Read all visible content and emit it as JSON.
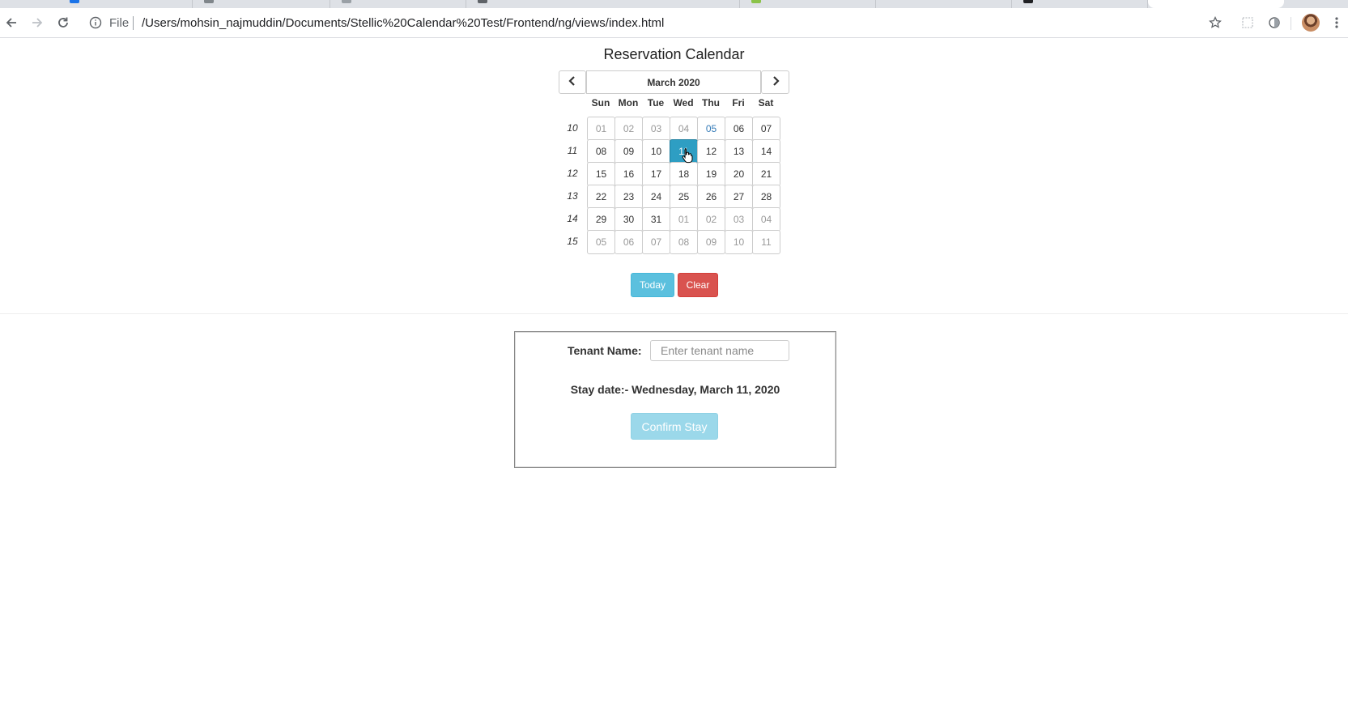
{
  "browser": {
    "scheme_label": "File",
    "url": "/Users/mohsin_najmuddin/Documents/Stellic%20Calendar%20Test/Frontend/ng/views/index.html",
    "icons": [
      "back-arrow-icon",
      "forward-arrow-icon",
      "reload-icon",
      "info-icon",
      "bookmark-star-icon",
      "extension-icon",
      "profile-circle-icon",
      "avatar",
      "more-vert-icon"
    ]
  },
  "page": {
    "title": "Reservation Calendar"
  },
  "calendar": {
    "month_label": "March 2020",
    "weekday_headers": [
      "Sun",
      "Mon",
      "Tue",
      "Wed",
      "Thu",
      "Fri",
      "Sat"
    ],
    "weeks": [
      {
        "number": "10",
        "days": [
          {
            "label": "01",
            "state": "muted"
          },
          {
            "label": "02",
            "state": "muted"
          },
          {
            "label": "03",
            "state": "muted"
          },
          {
            "label": "04",
            "state": "muted"
          },
          {
            "label": "05",
            "state": "today"
          },
          {
            "label": "06",
            "state": "normal"
          },
          {
            "label": "07",
            "state": "normal"
          }
        ]
      },
      {
        "number": "11",
        "days": [
          {
            "label": "08",
            "state": "normal"
          },
          {
            "label": "09",
            "state": "normal"
          },
          {
            "label": "10",
            "state": "normal"
          },
          {
            "label": "11",
            "state": "active"
          },
          {
            "label": "12",
            "state": "normal"
          },
          {
            "label": "13",
            "state": "normal"
          },
          {
            "label": "14",
            "state": "normal"
          }
        ]
      },
      {
        "number": "12",
        "days": [
          {
            "label": "15",
            "state": "normal"
          },
          {
            "label": "16",
            "state": "normal"
          },
          {
            "label": "17",
            "state": "normal"
          },
          {
            "label": "18",
            "state": "normal"
          },
          {
            "label": "19",
            "state": "normal"
          },
          {
            "label": "20",
            "state": "normal"
          },
          {
            "label": "21",
            "state": "normal"
          }
        ]
      },
      {
        "number": "13",
        "days": [
          {
            "label": "22",
            "state": "normal"
          },
          {
            "label": "23",
            "state": "normal"
          },
          {
            "label": "24",
            "state": "normal"
          },
          {
            "label": "25",
            "state": "normal"
          },
          {
            "label": "26",
            "state": "normal"
          },
          {
            "label": "27",
            "state": "normal"
          },
          {
            "label": "28",
            "state": "normal"
          }
        ]
      },
      {
        "number": "14",
        "days": [
          {
            "label": "29",
            "state": "normal"
          },
          {
            "label": "30",
            "state": "normal"
          },
          {
            "label": "31",
            "state": "normal"
          },
          {
            "label": "01",
            "state": "muted"
          },
          {
            "label": "02",
            "state": "muted"
          },
          {
            "label": "03",
            "state": "muted"
          },
          {
            "label": "04",
            "state": "muted"
          }
        ]
      },
      {
        "number": "15",
        "days": [
          {
            "label": "05",
            "state": "muted"
          },
          {
            "label": "06",
            "state": "muted"
          },
          {
            "label": "07",
            "state": "muted"
          },
          {
            "label": "08",
            "state": "muted"
          },
          {
            "label": "09",
            "state": "muted"
          },
          {
            "label": "10",
            "state": "muted"
          },
          {
            "label": "11",
            "state": "muted"
          }
        ]
      }
    ],
    "today_button": "Today",
    "clear_button": "Clear"
  },
  "form": {
    "tenant_label": "Tenant Name:",
    "tenant_placeholder": "Enter tenant name",
    "tenant_value": "",
    "stay_date_text": "Stay date:- Wednesday, March 11, 2020",
    "confirm_button": "Confirm Stay"
  },
  "colors": {
    "active_day": "#2e9ec3",
    "today_text": "#337ab7",
    "info_button": "#5bc0de",
    "danger_button": "#d9534f",
    "confirm_disabled": "#9bd8ea"
  }
}
